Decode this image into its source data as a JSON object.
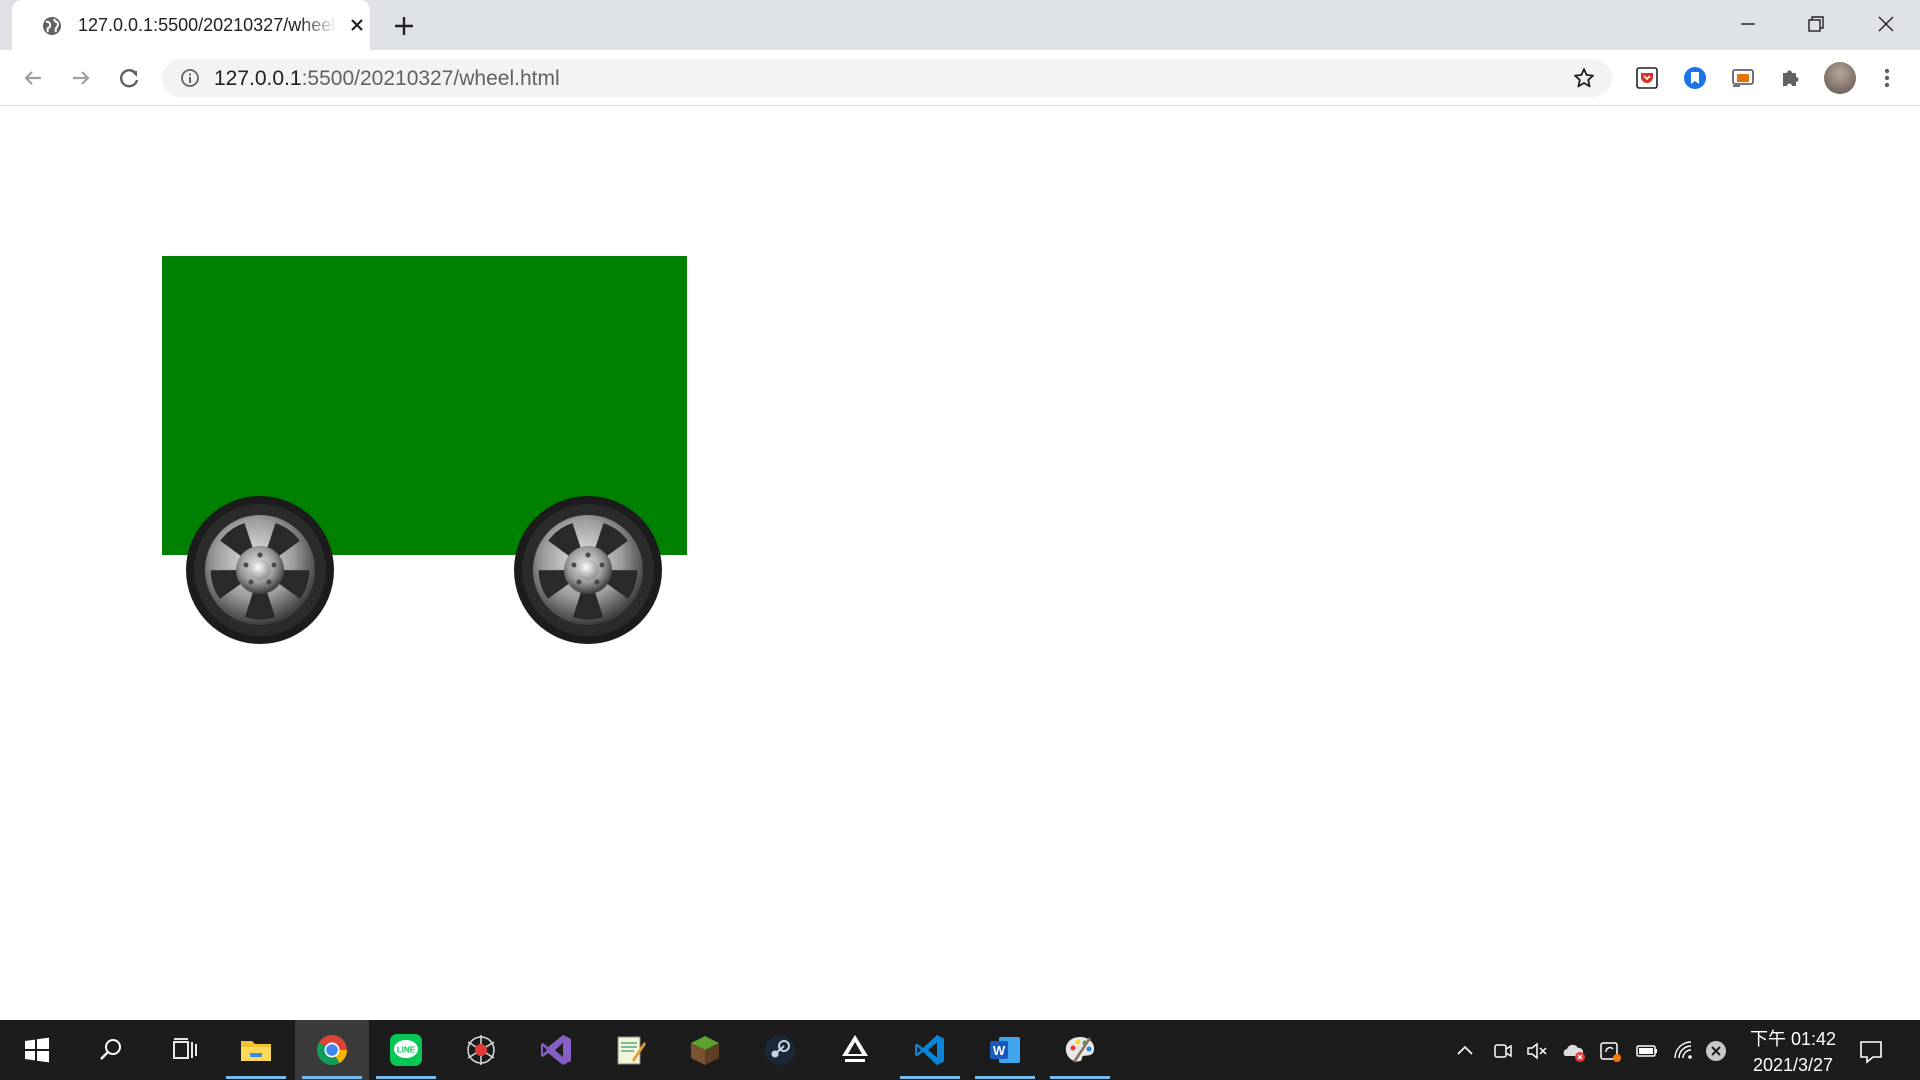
{
  "browser": {
    "tab_title": "127.0.0.1:5500/20210327/wheel.html",
    "url_host": "127.0.0.1",
    "url_rest": ":5500/20210327/wheel.html"
  },
  "page": {
    "car_body_color": "#008000",
    "wheel_count": 2
  },
  "taskbar": {
    "apps": [
      "start",
      "search",
      "task-view",
      "file-explorer",
      "chrome",
      "line",
      "spider-app",
      "visual-studio",
      "notepad-app",
      "minecraft",
      "steam",
      "inkscape",
      "vscode",
      "word",
      "paint"
    ],
    "clock_time": "下午 01:42",
    "clock_date": "2021/3/27"
  }
}
